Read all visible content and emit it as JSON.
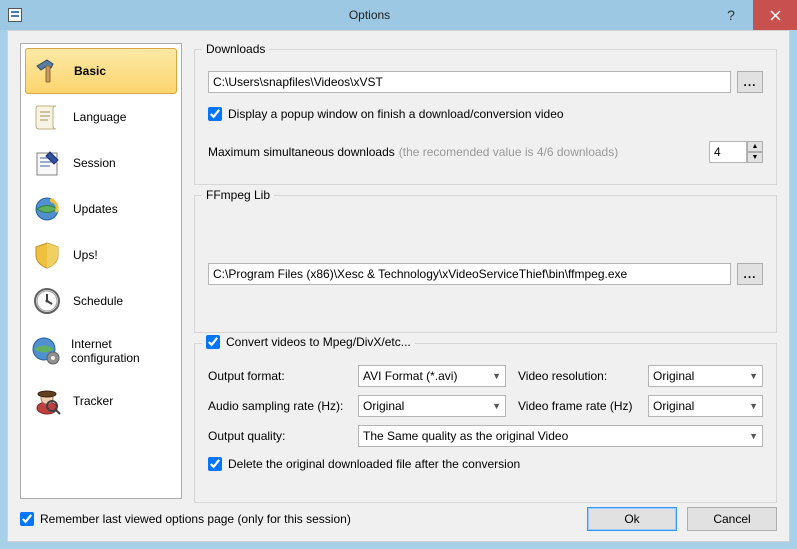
{
  "window": {
    "title": "Options"
  },
  "sidebar": {
    "items": [
      {
        "label": "Basic"
      },
      {
        "label": "Language"
      },
      {
        "label": "Session"
      },
      {
        "label": "Updates"
      },
      {
        "label": "Ups!"
      },
      {
        "label": "Schedule"
      },
      {
        "label": "Internet configuration"
      },
      {
        "label": "Tracker"
      }
    ]
  },
  "downloads": {
    "legend": "Downloads",
    "path": "C:\\Users\\snapfiles\\Videos\\xVST",
    "browse": "...",
    "popup_label": "Display a popup window on finish a download/conversion video",
    "max_label": "Maximum simultaneous downloads",
    "max_hint": "(the recomended value is 4/6 downloads)",
    "max_value": "4"
  },
  "ffmpeg": {
    "legend": "FFmpeg Lib",
    "path": "C:\\Program Files (x86)\\Xesc & Technology\\xVideoServiceThief\\bin\\ffmpeg.exe",
    "browse": "..."
  },
  "convert": {
    "checkbox_label": "Convert videos to Mpeg/DivX/etc...",
    "output_format_label": "Output format:",
    "output_format_value": "AVI Format (*.avi)",
    "video_res_label": "Video resolution:",
    "video_res_value": "Original",
    "audio_rate_label": "Audio sampling rate (Hz):",
    "audio_rate_value": "Original",
    "frame_rate_label": "Video frame rate (Hz)",
    "frame_rate_value": "Original",
    "quality_label": "Output quality:",
    "quality_value": "The Same quality as the original Video",
    "delete_label": "Delete the original downloaded file after the conversion"
  },
  "footer": {
    "remember": "Remember last viewed options page (only for this session)",
    "ok": "Ok",
    "cancel": "Cancel"
  }
}
